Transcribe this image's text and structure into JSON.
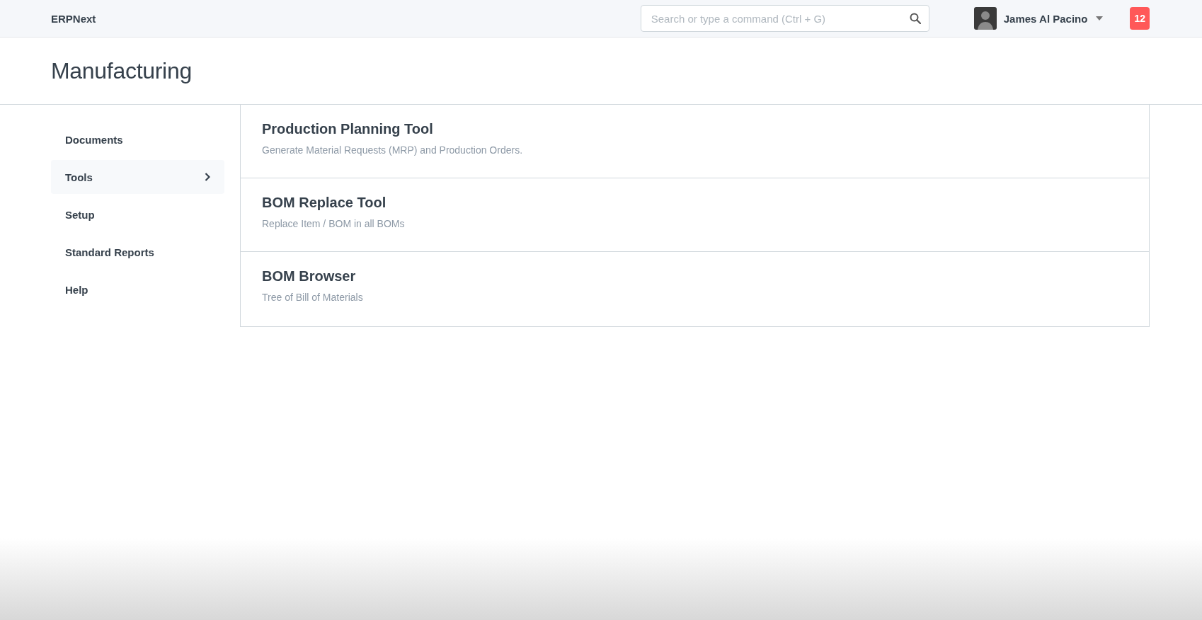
{
  "navbar": {
    "brand": "ERPNext",
    "search": {
      "placeholder": "Search or type a command (Ctrl + G)"
    },
    "user": {
      "name": "James Al Pacino"
    },
    "notifications": "12"
  },
  "page": {
    "title": "Manufacturing"
  },
  "sidebar": {
    "items": [
      {
        "label": "Documents",
        "selected": false
      },
      {
        "label": "Tools",
        "selected": true
      },
      {
        "label": "Setup",
        "selected": false
      },
      {
        "label": "Standard Reports",
        "selected": false
      },
      {
        "label": "Help",
        "selected": false
      }
    ]
  },
  "tools": [
    {
      "title": "Production Planning Tool",
      "description": "Generate Material Requests (MRP) and Production Orders."
    },
    {
      "title": "BOM Replace Tool",
      "description": "Replace Item / BOM in all BOMs"
    },
    {
      "title": "BOM Browser",
      "description": "Tree of Bill of Materials"
    }
  ]
}
